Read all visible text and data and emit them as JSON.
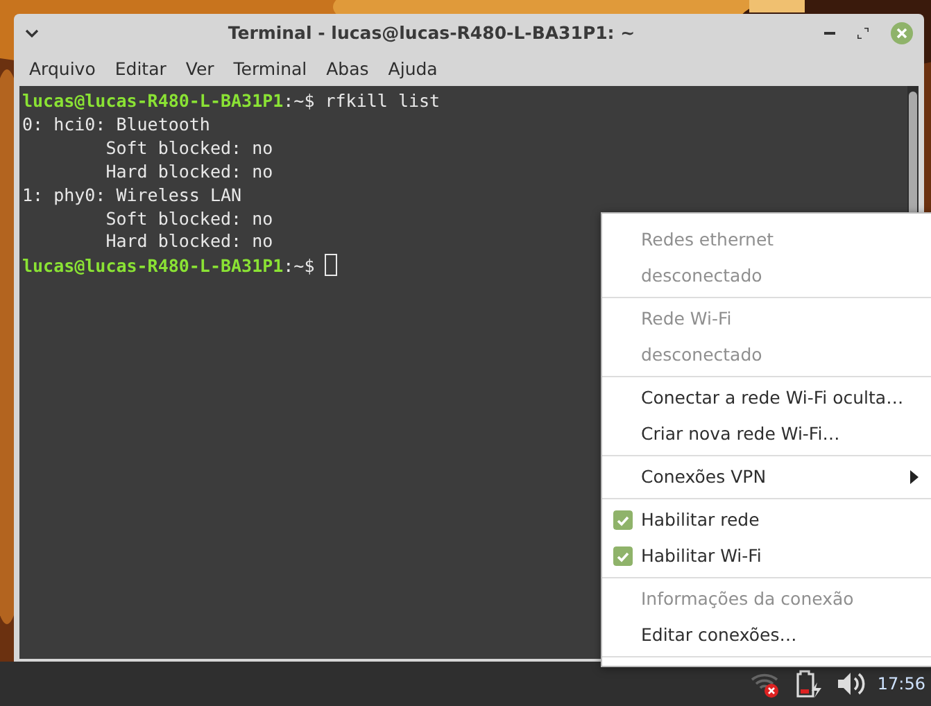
{
  "window": {
    "title": "Terminal - lucas@lucas-R480-L-BA31P1: ~"
  },
  "menu_bar": [
    "Arquivo",
    "Editar",
    "Ver",
    "Terminal",
    "Abas",
    "Ajuda"
  ],
  "terminal": {
    "lines": [
      {
        "kind": "prompt",
        "prompt": "lucas@lucas-R480-L-BA31P1",
        "path": ":~$ ",
        "command": "rfkill list",
        "cursor": false
      },
      {
        "kind": "output",
        "text": "0: hci0: Bluetooth"
      },
      {
        "kind": "output",
        "text": "        Soft blocked: no"
      },
      {
        "kind": "output",
        "text": "        Hard blocked: no"
      },
      {
        "kind": "output",
        "text": "1: phy0: Wireless LAN"
      },
      {
        "kind": "output",
        "text": "        Soft blocked: no"
      },
      {
        "kind": "output",
        "text": "        Hard blocked: no"
      },
      {
        "kind": "prompt",
        "prompt": "lucas@lucas-R480-L-BA31P1",
        "path": ":~$ ",
        "cursor": true
      }
    ]
  },
  "network_menu": {
    "sections": [
      [
        {
          "kind": "item",
          "label": "Redes ethernet",
          "disabled": true
        },
        {
          "kind": "item",
          "label": "desconectado",
          "disabled": true
        }
      ],
      [
        {
          "kind": "item",
          "label": "Rede Wi-Fi",
          "disabled": true
        },
        {
          "kind": "item",
          "label": "desconectado",
          "disabled": true
        }
      ],
      [
        {
          "kind": "item",
          "label": "Conectar a rede Wi-Fi oculta…",
          "disabled": false
        },
        {
          "kind": "item",
          "label": "Criar nova rede Wi-Fi…",
          "disabled": false
        }
      ],
      [
        {
          "kind": "submenu",
          "label": "Conexões VPN",
          "disabled": false
        }
      ],
      [
        {
          "kind": "check",
          "label": "Habilitar rede",
          "checked": true
        },
        {
          "kind": "check",
          "label": "Habilitar Wi-Fi",
          "checked": true
        }
      ],
      [
        {
          "kind": "item",
          "label": "Informações da conexão",
          "disabled": true
        },
        {
          "kind": "item",
          "label": "Editar conexões…",
          "disabled": false
        }
      ]
    ]
  },
  "panel": {
    "clock": "17:56"
  }
}
